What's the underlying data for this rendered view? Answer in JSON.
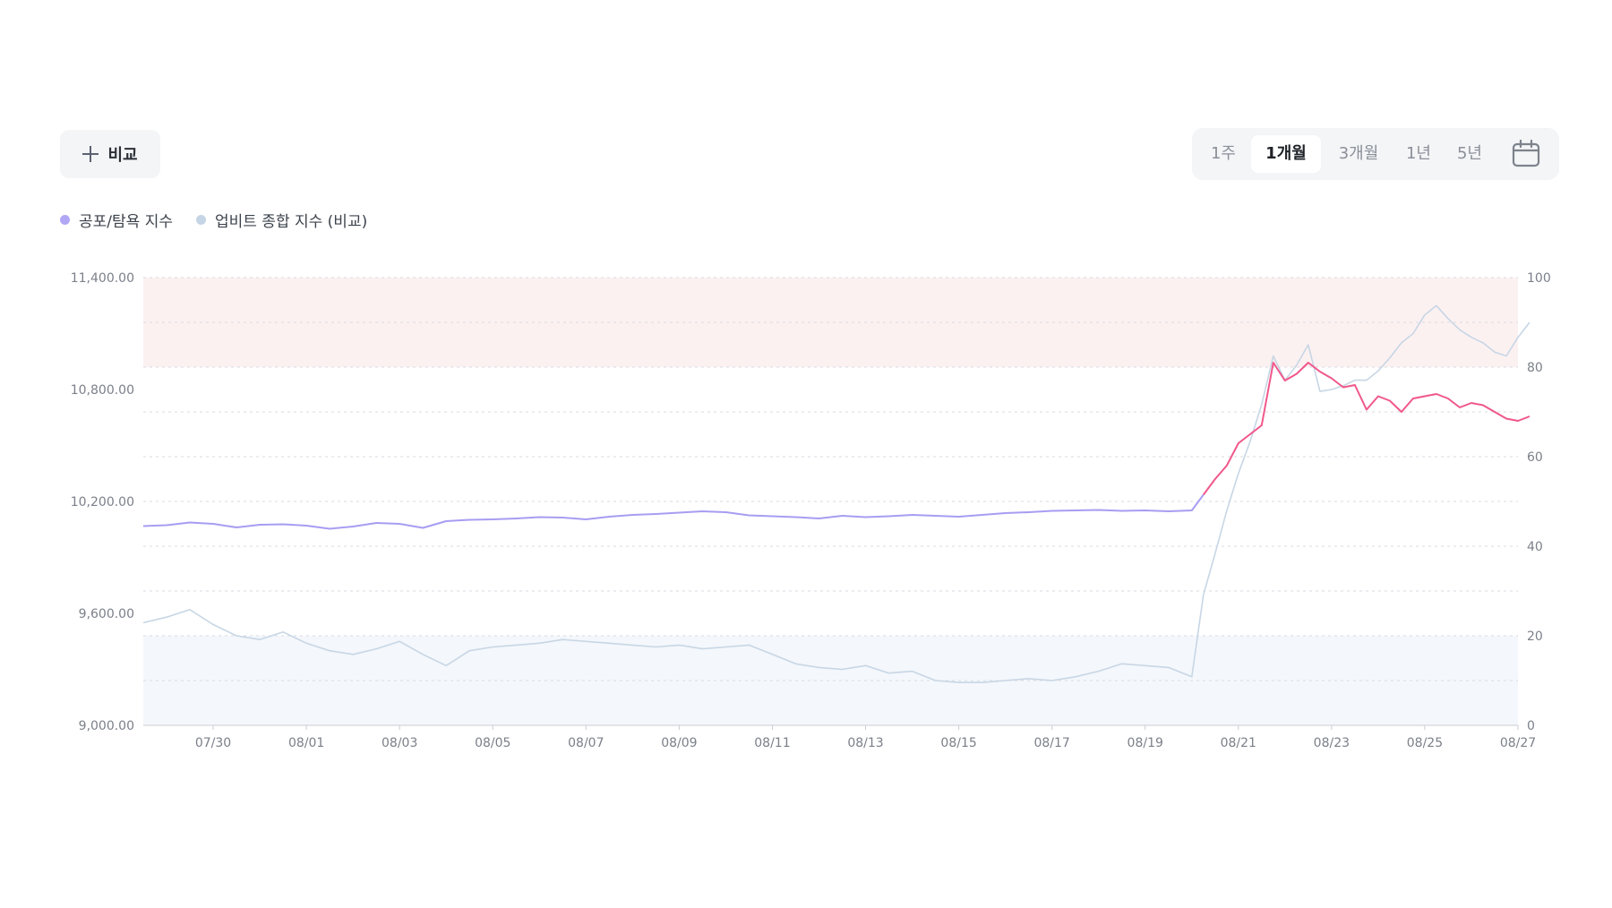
{
  "toolbar": {
    "compare_label": "비교",
    "ranges": [
      "1주",
      "1개월",
      "3개월",
      "1년",
      "5년"
    ],
    "active_range": "1개월",
    "calendar_icon": "calendar-icon"
  },
  "legend": [
    {
      "label": "공포/탐욕 지수",
      "color": "#b0a8f4"
    },
    {
      "label": "업비트 종합 지수 (비교)",
      "color": "#c5d5e6"
    }
  ],
  "colors": {
    "fear_greed_line": "#a79df2",
    "fear_greed_greed_line": "#f0578a",
    "compare_line": "#c7d6e5",
    "greed_zone": "#fcf1f1",
    "fear_zone": "#f4f7fb",
    "grid": "#d7dbe1"
  },
  "chart_data": {
    "type": "line",
    "title": "",
    "x_tick_labels": [
      "07/30",
      "08/01",
      "08/03",
      "08/05",
      "08/07",
      "08/09",
      "08/11",
      "08/13",
      "08/15",
      "08/17",
      "08/19",
      "08/21",
      "08/23",
      "08/25",
      "08/27"
    ],
    "x_start": "07/28 12:00",
    "x_end": "08/27",
    "left_axis": {
      "ticks": [
        "11,400.00",
        "10,800.00",
        "10,200.00",
        "9,600.00",
        "9,000.00"
      ],
      "range": [
        9000,
        11400
      ]
    },
    "right_axis": {
      "ticks": [
        "100",
        "80",
        "60",
        "40",
        "20",
        "0"
      ],
      "range": [
        0,
        100
      ]
    },
    "zones": [
      {
        "name": "greed",
        "from": 80,
        "to": 100
      },
      {
        "name": "fear",
        "from": 0,
        "to": 20
      }
    ],
    "grid": true,
    "legend_position": "top-left",
    "series": [
      {
        "name": "공포/탐욕 지수",
        "axis": "right",
        "x": [
          "07/28 12:00",
          "07/29 00:00",
          "07/29 12:00",
          "07/30 00:00",
          "07/30 12:00",
          "07/31 00:00",
          "07/31 12:00",
          "08/01 00:00",
          "08/01 12:00",
          "08/02 00:00",
          "08/02 12:00",
          "08/03 00:00",
          "08/03 12:00",
          "08/04 00:00",
          "08/04 12:00",
          "08/05 00:00",
          "08/05 12:00",
          "08/06 00:00",
          "08/06 12:00",
          "08/07 00:00",
          "08/07 12:00",
          "08/08 00:00",
          "08/08 12:00",
          "08/09 00:00",
          "08/09 12:00",
          "08/10 00:00",
          "08/10 12:00",
          "08/11 00:00",
          "08/11 12:00",
          "08/12 00:00",
          "08/12 12:00",
          "08/13 00:00",
          "08/13 12:00",
          "08/14 00:00",
          "08/14 12:00",
          "08/15 00:00",
          "08/15 12:00",
          "08/16 00:00",
          "08/16 12:00",
          "08/17 00:00",
          "08/17 12:00",
          "08/18 00:00",
          "08/18 12:00",
          "08/19 00:00",
          "08/19 12:00",
          "08/20 00:00",
          "08/20 06:00",
          "08/20 12:00",
          "08/20 18:00",
          "08/21 00:00",
          "08/21 06:00",
          "08/21 12:00",
          "08/21 18:00",
          "08/22 00:00",
          "08/22 06:00",
          "08/22 12:00",
          "08/22 18:00",
          "08/23 00:00",
          "08/23 06:00",
          "08/23 12:00",
          "08/23 18:00",
          "08/24 00:00",
          "08/24 06:00",
          "08/24 12:00",
          "08/24 18:00",
          "08/25 00:00",
          "08/25 06:00",
          "08/25 12:00",
          "08/25 18:00",
          "08/26 00:00",
          "08/26 06:00",
          "08/26 12:00",
          "08/26 18:00",
          "08/27 00:00",
          "08/27 06:00"
        ],
        "values": [
          44.5,
          44.7,
          45.3,
          45.0,
          44.2,
          44.8,
          44.9,
          44.6,
          43.9,
          44.4,
          45.2,
          45.0,
          44.1,
          45.6,
          45.9,
          46.0,
          46.2,
          46.5,
          46.4,
          46.0,
          46.6,
          47.0,
          47.2,
          47.5,
          47.8,
          47.6,
          46.9,
          46.7,
          46.5,
          46.2,
          46.8,
          46.5,
          46.7,
          47.0,
          46.8,
          46.6,
          47.0,
          47.4,
          47.6,
          47.9,
          48.0,
          48.1,
          47.9,
          48.0,
          47.8,
          48.0,
          51.5,
          55.0,
          58.0,
          63.0,
          65.0,
          67.0,
          81.0,
          77.0,
          78.5,
          81.0,
          79.0,
          77.5,
          75.5,
          76.0,
          70.5,
          73.5,
          72.5,
          70.0,
          73.0,
          73.5,
          74.0,
          73.0,
          71.0,
          72.0,
          71.5,
          70.0,
          68.5,
          68.0,
          69.0
        ]
      },
      {
        "name": "업비트 종합 지수 (비교)",
        "axis": "left",
        "x": [
          "07/28 12:00",
          "07/29 00:00",
          "07/29 12:00",
          "07/30 00:00",
          "07/30 12:00",
          "07/31 00:00",
          "07/31 12:00",
          "08/01 00:00",
          "08/01 12:00",
          "08/02 00:00",
          "08/02 12:00",
          "08/03 00:00",
          "08/03 12:00",
          "08/04 00:00",
          "08/04 12:00",
          "08/05 00:00",
          "08/05 12:00",
          "08/06 00:00",
          "08/06 12:00",
          "08/07 00:00",
          "08/07 12:00",
          "08/08 00:00",
          "08/08 12:00",
          "08/09 00:00",
          "08/09 12:00",
          "08/10 00:00",
          "08/10 12:00",
          "08/11 00:00",
          "08/11 12:00",
          "08/12 00:00",
          "08/12 12:00",
          "08/13 00:00",
          "08/13 12:00",
          "08/14 00:00",
          "08/14 12:00",
          "08/15 00:00",
          "08/15 12:00",
          "08/16 00:00",
          "08/16 12:00",
          "08/17 00:00",
          "08/17 12:00",
          "08/18 00:00",
          "08/18 12:00",
          "08/19 00:00",
          "08/19 12:00",
          "08/20 00:00",
          "08/20 06:00",
          "08/20 12:00",
          "08/20 18:00",
          "08/21 00:00",
          "08/21 06:00",
          "08/21 12:00",
          "08/21 18:00",
          "08/22 00:00",
          "08/22 06:00",
          "08/22 12:00",
          "08/22 18:00",
          "08/23 00:00",
          "08/23 06:00",
          "08/23 12:00",
          "08/23 18:00",
          "08/24 00:00",
          "08/24 06:00",
          "08/24 12:00",
          "08/24 18:00",
          "08/25 00:00",
          "08/25 06:00",
          "08/25 12:00",
          "08/25 18:00",
          "08/26 00:00",
          "08/26 06:00",
          "08/26 12:00",
          "08/26 18:00",
          "08/27 00:00",
          "08/27 06:00"
        ],
        "values": [
          9550,
          9580,
          9620,
          9540,
          9480,
          9460,
          9500,
          9440,
          9400,
          9380,
          9410,
          9450,
          9380,
          9320,
          9400,
          9420,
          9430,
          9440,
          9460,
          9450,
          9440,
          9430,
          9420,
          9430,
          9410,
          9420,
          9430,
          9380,
          9330,
          9310,
          9300,
          9320,
          9280,
          9290,
          9240,
          9230,
          9230,
          9240,
          9250,
          9240,
          9260,
          9290,
          9330,
          9320,
          9310,
          9260,
          9700,
          9920,
          10150,
          10350,
          10520,
          10720,
          10980,
          10850,
          10930,
          11040,
          10790,
          10800,
          10820,
          10850,
          10850,
          10900,
          10970,
          11050,
          11100,
          11200,
          11250,
          11180,
          11120,
          11080,
          11050,
          11000,
          10980,
          11080,
          11160
        ]
      }
    ]
  }
}
